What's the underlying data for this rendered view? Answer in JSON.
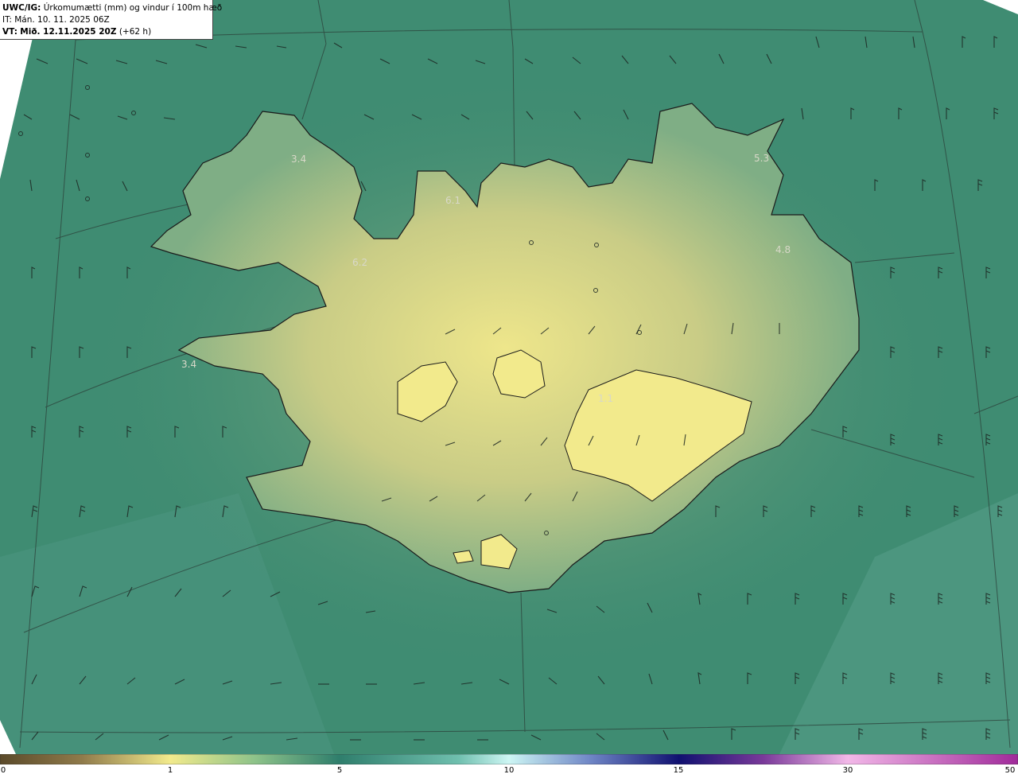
{
  "header": {
    "model_label": "UWC/IG:",
    "title": "Úrkomumætti (mm) og vindur í 100m hæð",
    "init_time": "IT: Mán. 10. 11. 2025 06Z",
    "valid_label": "VT:",
    "valid_time": "Mið. 12.11.2025 20Z",
    "lead_time": "(+62 h)"
  },
  "map_labels": [
    {
      "id": "westfjords-max",
      "text": "3.4"
    },
    {
      "id": "north-west-max",
      "text": "6.1"
    },
    {
      "id": "west-max",
      "text": "6.2"
    },
    {
      "id": "northeast-max",
      "text": "5.3"
    },
    {
      "id": "east-max",
      "text": "4.8"
    },
    {
      "id": "snaefellsnes-max",
      "text": "3.4"
    },
    {
      "id": "vatnajokull-max",
      "text": "1.1"
    }
  ],
  "colorbar": {
    "ticks": [
      "0",
      "1",
      "5",
      "10",
      "15",
      "30",
      "50"
    ],
    "colors": [
      "#5b4a2a",
      "#8f7a4a",
      "#c9b765",
      "#f2ea8c",
      "#8ec38a",
      "#3e8c6f",
      "#2f7e6c",
      "#6fbfae",
      "#bdf0f0",
      "#6f86c6",
      "#1e1f8a",
      "#5a2a8a",
      "#b56fc0",
      "#f2b8e8",
      "#b03aa8"
    ]
  }
}
